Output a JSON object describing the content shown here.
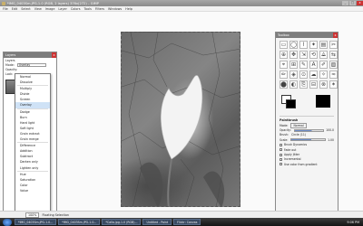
{
  "window": {
    "title": "*IMG_0403Sm.JPG-1.0 (RGB, 2 layers) 376x(272) – GIMP"
  },
  "window_controls": {
    "minimize": "_",
    "maximize": "□",
    "close": "x"
  },
  "menu": [
    "File",
    "Edit",
    "Select",
    "View",
    "Image",
    "Layer",
    "Colors",
    "Tools",
    "Filters",
    "Windows",
    "Help"
  ],
  "layers_dialog": {
    "title": "Layers",
    "row1": "Layers",
    "mode_label": "Mode:",
    "mode_value": "Overlay",
    "opacity_label": "Opacity:",
    "lock_label": "Lock:"
  },
  "mode_options": [
    "Normal",
    "Dissolve",
    "Multiply",
    "Divide",
    "Screen",
    "Overlay",
    "Dodge",
    "Burn",
    "Hard light",
    "Soft light",
    "Grain extract",
    "Grain merge",
    "Difference",
    "Addition",
    "Subtract",
    "Darken only",
    "Lighten only",
    "Hue",
    "Saturation",
    "Color",
    "Value"
  ],
  "mode_selected": "Overlay",
  "toolbox": {
    "title": "Toolbox",
    "tools": [
      "▭",
      "◯",
      "⌇",
      "✦",
      "▤",
      "✂",
      "⊕",
      "✥",
      "⇲",
      "⟲",
      "⟁",
      "⇆",
      "⌖",
      "⊞",
      "✎",
      "A",
      "✐",
      "▨",
      "✏",
      "◈",
      "⊙",
      "☁",
      "✧",
      "≈",
      "⬤",
      "◐",
      "⎘",
      "⊟",
      "⊗",
      "✶"
    ],
    "options": {
      "title": "Paintbrush",
      "mode_label": "Mode:",
      "mode_value": "Normal",
      "opacity_label": "Opacity:",
      "opacity_value": "100.0",
      "brush_label": "Brush:",
      "brush_value": "Circle (11)",
      "scale_label": "Scale:",
      "scale_value": "1.00",
      "checkboxes": [
        "Brush Dynamics",
        "Fade out",
        "Apply Jitter",
        "Incremental",
        "Use color from gradient"
      ]
    },
    "fg_color": "#ffffff",
    "bg_color": "#000000"
  },
  "statusbar": {
    "zoom": "100%",
    "message": "Floating Selection"
  },
  "taskbar": {
    "tasks": [
      "*IMG_0403Sm.JPG-1.0...",
      "*IMG_0403Sm.JPG-1.0...",
      "*Calla.jpg-1.0 (RGB)...",
      "Untitled - Paint",
      "Flickr: Canvas"
    ],
    "clock": "9:06 PM"
  }
}
